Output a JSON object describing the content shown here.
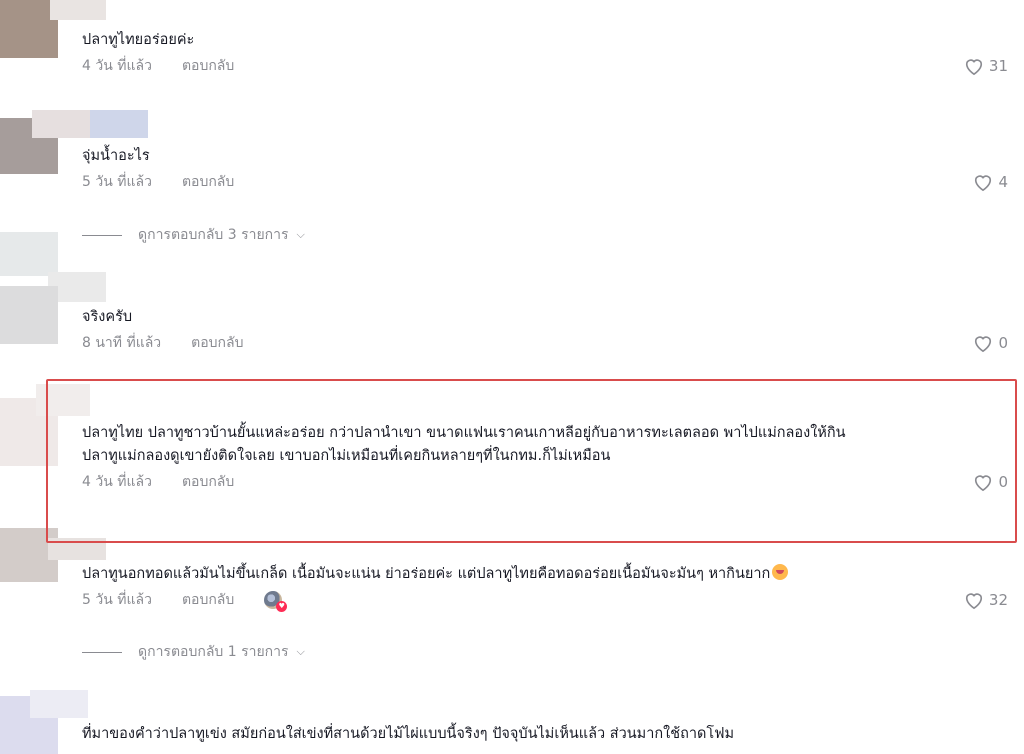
{
  "colors": {
    "text": "#161823",
    "muted": "#8a8b91",
    "highlight": "#d94c4c",
    "accent": "#fe2c55"
  },
  "comments": [
    {
      "text": "ปลาทูไทยอร่อยค่ะ",
      "time": "4 วัน ที่แล้ว",
      "reply": "ตอบกลับ",
      "likes": "31"
    },
    {
      "text": "จุ่มน้ำอะไร",
      "time": "5 วัน ที่แล้ว",
      "reply": "ตอบกลับ",
      "likes": "4",
      "view_replies": "ดูการตอบกลับ 3 รายการ"
    },
    {
      "text": "จริงครับ",
      "time": "8 นาที ที่แล้ว",
      "reply": "ตอบกลับ",
      "likes": "0"
    },
    {
      "text_line1": "ปลาทูไทย ปลาทูชาวบ้านยั้นแหล่ะอร่อย กว่าปลานำเขา ขนาดแฟนเราคนเกาหลีอยู่กับอาหารทะเลตลอด พาไปแม่กลองให้กิน",
      "text_line2": "ปลาทูแม่กลองดูเขายังติดใจเลย เขาบอกไม่เหมือนที่เคยกินหลายๆที่ในกทม.ก็ไม่เหมือน",
      "time": "4 วัน ที่แล้ว",
      "reply": "ตอบกลับ",
      "likes": "0"
    },
    {
      "text": "ปลาทูนอกทอดแล้วมันไม่ขึ้นเกล็ด เนื้อมันจะแน่น ย่าอร่อยค่ะ แต่ปลาทูไทยคือทอดอร่อยเนื้อมันจะมันๆ หากินยาก",
      "time": "5 วัน ที่แล้ว",
      "reply": "ตอบกลับ",
      "likes": "32",
      "view_replies": "ดูการตอบกลับ 1 รายการ"
    },
    {
      "text": "ที่มาของคำว่าปลาทูเข่ง สมัยก่อนใส่เข่งที่สานด้วยไม้ไผ่แบบนี้จริงๆ ปัจจุบันไม่เห็นแล้ว ส่วนมากใช้ถาดโฟม"
    }
  ],
  "icons": {
    "like": "heart-outline-icon",
    "expand": "chevron-down-icon"
  }
}
